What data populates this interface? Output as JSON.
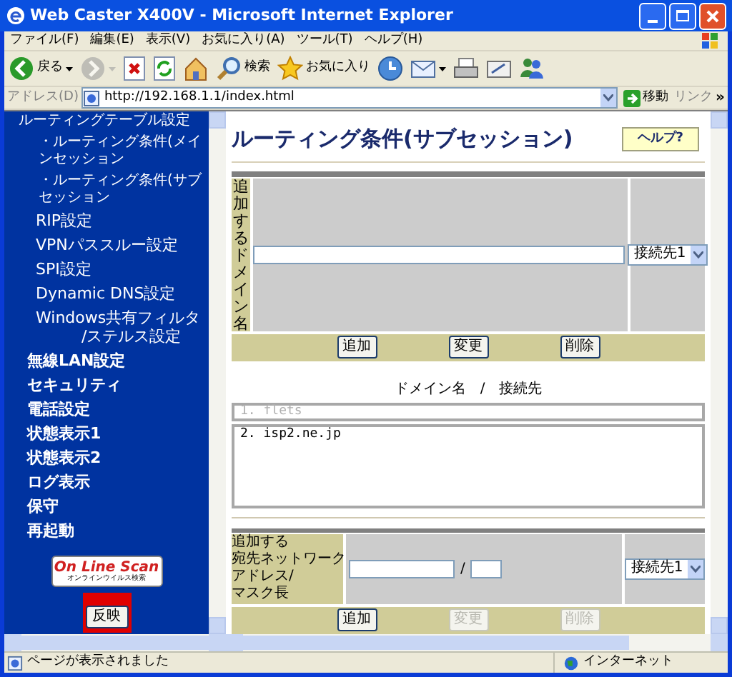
{
  "window": {
    "title": "Web Caster X400V - Microsoft Internet Explorer"
  },
  "menu": [
    "ファイル(F)",
    "編集(E)",
    "表示(V)",
    "お気に入り(A)",
    "ツール(T)",
    "ヘルプ(H)"
  ],
  "toolbar": [
    {
      "kind": "back",
      "label": "戻る",
      "disabled": false,
      "dropdown": true
    },
    {
      "kind": "forward",
      "disabled": true,
      "dropdown": true
    },
    {
      "kind": "stop",
      "disabled": false
    },
    {
      "kind": "refresh",
      "disabled": false
    },
    {
      "kind": "home",
      "disabled": false
    },
    {
      "kind": "search",
      "label": "検索",
      "disabled": false
    },
    {
      "kind": "favorites",
      "label": "お気に入り",
      "disabled": false
    },
    {
      "kind": "history",
      "disabled": false
    },
    {
      "kind": "mail",
      "disabled": false,
      "dropdown": true
    },
    {
      "kind": "print",
      "disabled": false
    },
    {
      "kind": "edit",
      "disabled": false
    },
    {
      "kind": "messenger",
      "disabled": false
    }
  ],
  "address_bar": {
    "label": "アドレス(D)",
    "value": "http://192.168.1.1/index.html",
    "go": "移動",
    "links": "リンク",
    "more": "»"
  },
  "sidebar": {
    "items": [
      {
        "kind": "cut",
        "lines": [
          "ルーティングテーブル設定"
        ]
      },
      {
        "kind": "sub",
        "lines": [
          "・ルーティング条件(メインセッション"
        ]
      },
      {
        "kind": "sub",
        "lines": [
          "・ルーティング条件(サブセッション"
        ]
      },
      {
        "kind": "item",
        "lines": [
          "RIP設定"
        ]
      },
      {
        "kind": "item",
        "lines": [
          "VPNパススルー設定"
        ]
      },
      {
        "kind": "item",
        "lines": [
          "SPI設定"
        ]
      },
      {
        "kind": "item",
        "lines": [
          "Dynamic DNS設定"
        ]
      },
      {
        "kind": "item",
        "lines": [
          "Windows共有フィルタ",
          "/ステルス設定"
        ]
      },
      {
        "kind": "main",
        "lines": [
          "無線LAN設定"
        ]
      },
      {
        "kind": "main",
        "lines": [
          "セキュリティ"
        ]
      },
      {
        "kind": "main",
        "lines": [
          "電話設定"
        ]
      },
      {
        "kind": "main",
        "lines": [
          "状態表示1"
        ]
      },
      {
        "kind": "main",
        "lines": [
          "状態表示2"
        ]
      },
      {
        "kind": "main",
        "lines": [
          "ログ表示"
        ]
      },
      {
        "kind": "main",
        "lines": [
          "保守"
        ]
      },
      {
        "kind": "main",
        "lines": [
          "再起動"
        ]
      }
    ],
    "scan_banner": {
      "title": "On Line Scan",
      "subtitle": "オンラインウイルス検索"
    },
    "apply_button": {
      "label": "反映",
      "highlighted": true
    }
  },
  "page": {
    "heading": "ルーティング条件(サブセッション)",
    "help_button": "ヘルプ?",
    "domain_form": {
      "label": "追加するドメイン名",
      "select": "接続先1",
      "buttons": [
        {
          "label": "追加",
          "disabled": false
        },
        {
          "label": "変更",
          "disabled": false
        },
        {
          "label": "削除",
          "disabled": false
        }
      ]
    },
    "list_header": [
      "ドメイン名",
      "/",
      "接続先"
    ],
    "fixed_entry": {
      "text": "1. flets",
      "disabled": true
    },
    "entries": [
      "2. isp2.ne.jp"
    ],
    "network_form": {
      "label_lines": [
        "追加する",
        "宛先ネットワーク",
        "アドレス/",
        "マスク長"
      ],
      "separator": "/",
      "select": "接続先1",
      "buttons": [
        {
          "label": "追加",
          "disabled": false
        },
        {
          "label": "変更",
          "disabled": true
        },
        {
          "label": "削除",
          "disabled": true
        }
      ]
    }
  },
  "status_bar": {
    "text": "ページが表示されました",
    "zone": "インターネット"
  }
}
